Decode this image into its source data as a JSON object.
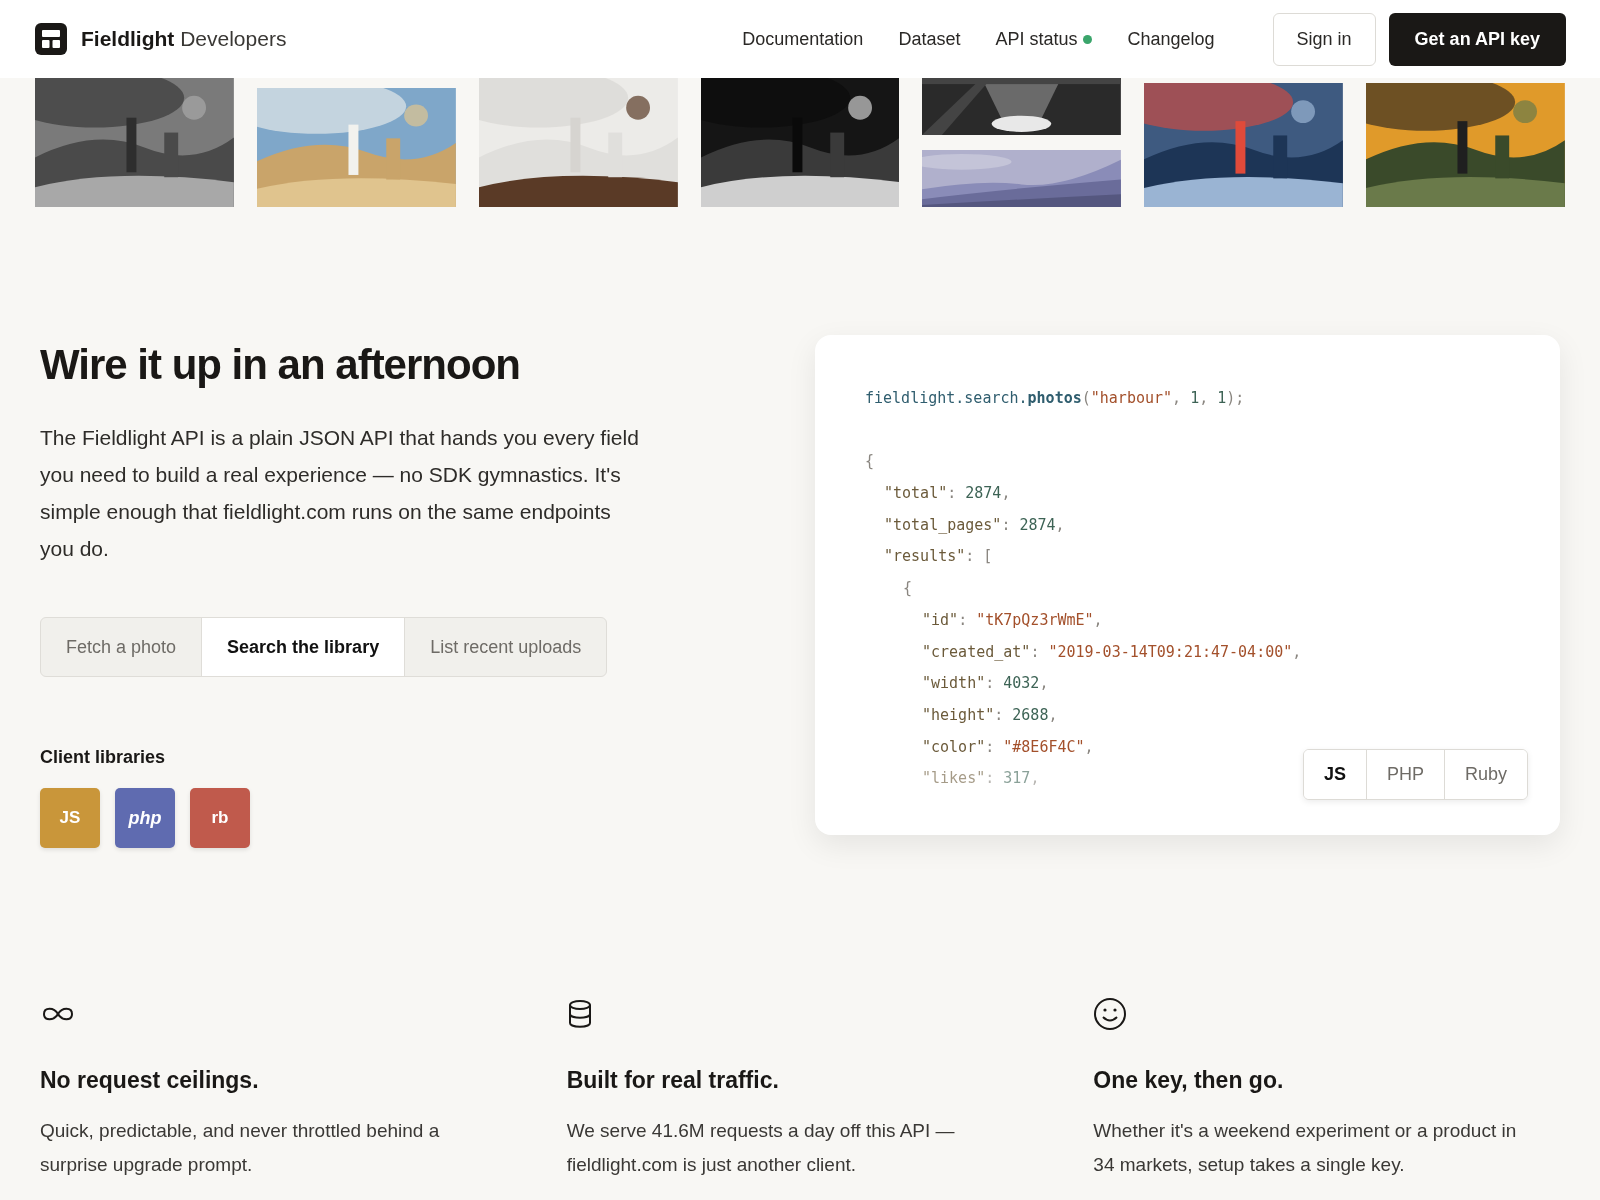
{
  "header": {
    "brand_bold": "Fieldlight",
    "brand_light": "Developers",
    "nav": [
      {
        "label": "Documentation"
      },
      {
        "label": "Dataset"
      },
      {
        "label": "API status",
        "color": "#3aa56b"
      },
      {
        "label": "Changelog"
      }
    ],
    "sign_in": "Sign in",
    "cta": "Get an API key"
  },
  "photo_strip": [
    {
      "kind": "single"
    },
    {
      "kind": "single"
    },
    {
      "kind": "single"
    },
    {
      "kind": "single"
    },
    {
      "kind": "pair"
    },
    {
      "kind": "single"
    },
    {
      "kind": "single"
    }
  ],
  "intro": {
    "title": "Wire it up in an afternoon",
    "body": "The Fieldlight API is a plain JSON API that hands you every field you need to build a real experience — no SDK gymnastics. It's simple enough that fieldlight.com runs on the same endpoints you do.",
    "tabs": [
      {
        "label": "Fetch a photo",
        "selected": false
      },
      {
        "label": "Search the library",
        "selected": true
      },
      {
        "label": "List recent uploads",
        "selected": false
      }
    ],
    "libraries_title": "Client libraries",
    "libraries": [
      {
        "label": "JS",
        "color": "#c9963a",
        "italic": false
      },
      {
        "label": "php",
        "color": "#5f6bb0",
        "italic": true
      },
      {
        "label": "rb",
        "color": "#c05a4c",
        "italic": false
      }
    ]
  },
  "code": {
    "lines": [
      {
        "kind": "line",
        "faded": false,
        "tokens": [
          {
            "kind": "obj",
            "text": "fieldlight.search."
          },
          {
            "kind": "fn",
            "text": "photos"
          },
          {
            "kind": "punct",
            "text": "("
          },
          {
            "kind": "str",
            "text": "\"harbour\""
          },
          {
            "kind": "punct",
            "text": ", "
          },
          {
            "kind": "num",
            "text": "1"
          },
          {
            "kind": "punct",
            "text": ", "
          },
          {
            "kind": "num",
            "text": "1"
          },
          {
            "kind": "punct",
            "text": ");"
          }
        ]
      },
      {
        "kind": "blank"
      },
      {
        "kind": "line",
        "faded": false,
        "tokens": [
          {
            "kind": "punct",
            "text": "{"
          }
        ],
        "children": [
          {
            "kind": "line",
            "faded": false,
            "tokens": [
              {
                "kind": "key",
                "text": "\"total\""
              },
              {
                "kind": "punct",
                "text": ": "
              },
              {
                "kind": "num",
                "text": "2874"
              },
              {
                "kind": "punct",
                "text": ","
              }
            ]
          },
          {
            "kind": "line",
            "faded": false,
            "tokens": [
              {
                "kind": "key",
                "text": "\"total_pages\""
              },
              {
                "kind": "punct",
                "text": ": "
              },
              {
                "kind": "num",
                "text": "2874"
              },
              {
                "kind": "punct",
                "text": ","
              }
            ]
          },
          {
            "kind": "line",
            "faded": false,
            "tokens": [
              {
                "kind": "key",
                "text": "\"results\""
              },
              {
                "kind": "punct",
                "text": ": ["
              }
            ],
            "children": [
              {
                "kind": "line",
                "faded": false,
                "tokens": [
                  {
                    "kind": "punct",
                    "text": "{"
                  }
                ],
                "children": [
                  {
                    "kind": "line",
                    "faded": false,
                    "tokens": [
                      {
                        "kind": "key",
                        "text": "\"id\""
                      },
                      {
                        "kind": "punct",
                        "text": ": "
                      },
                      {
                        "kind": "str",
                        "text": "\"tK7pQz3rWmE\""
                      },
                      {
                        "kind": "punct",
                        "text": ","
                      }
                    ]
                  },
                  {
                    "kind": "line",
                    "faded": false,
                    "tokens": [
                      {
                        "kind": "key",
                        "text": "\"created_at\""
                      },
                      {
                        "kind": "punct",
                        "text": ": "
                      },
                      {
                        "kind": "str",
                        "text": "\"2019-03-14T09:21:47-04:00\""
                      },
                      {
                        "kind": "punct",
                        "text": ","
                      }
                    ]
                  },
                  {
                    "kind": "line",
                    "faded": false,
                    "tokens": [
                      {
                        "kind": "key",
                        "text": "\"width\""
                      },
                      {
                        "kind": "punct",
                        "text": ": "
                      },
                      {
                        "kind": "num",
                        "text": "4032"
                      },
                      {
                        "kind": "punct",
                        "text": ","
                      }
                    ]
                  },
                  {
                    "kind": "line",
                    "faded": false,
                    "tokens": [
                      {
                        "kind": "key",
                        "text": "\"height\""
                      },
                      {
                        "kind": "punct",
                        "text": ": "
                      },
                      {
                        "kind": "num",
                        "text": "2688"
                      },
                      {
                        "kind": "punct",
                        "text": ","
                      }
                    ]
                  },
                  {
                    "kind": "line",
                    "faded": false,
                    "tokens": [
                      {
                        "kind": "key",
                        "text": "\"color\""
                      },
                      {
                        "kind": "punct",
                        "text": ": "
                      },
                      {
                        "kind": "str",
                        "text": "\"#8E6F4C\""
                      },
                      {
                        "kind": "punct",
                        "text": ","
                      }
                    ]
                  },
                  {
                    "kind": "line",
                    "faded": true,
                    "tokens": [
                      {
                        "kind": "key",
                        "text": "\"likes\""
                      },
                      {
                        "kind": "punct",
                        "text": ": "
                      },
                      {
                        "kind": "num",
                        "text": "317"
                      },
                      {
                        "kind": "punct",
                        "text": ","
                      }
                    ]
                  }
                ]
              }
            ]
          }
        ]
      }
    ],
    "languages": [
      {
        "label": "JS",
        "selected": true
      },
      {
        "label": "PHP",
        "selected": false
      },
      {
        "label": "Ruby",
        "selected": false
      }
    ]
  },
  "features": [
    {
      "title": "No request ceilings.",
      "body": "Quick, predictable, and never throttled behind a surprise upgrade prompt."
    },
    {
      "title": "Built for real traffic.",
      "body": "We serve 41.6M requests a day off this API — fieldlight.com is just another client."
    },
    {
      "title": "One key, then go.",
      "body": "Whether it's a weekend experiment or a product in 34 markets, setup takes a single key."
    }
  ]
}
